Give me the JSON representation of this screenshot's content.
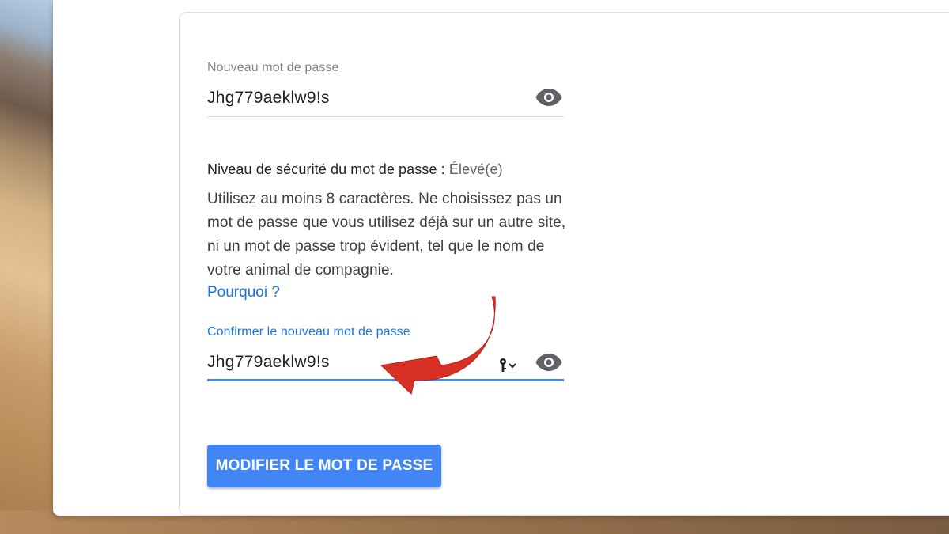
{
  "new_password": {
    "label": "Nouveau mot de passe",
    "value": "Jhg779aeklw9!s",
    "toggle_icon": "eye-icon"
  },
  "strength": {
    "label": "Niveau de sécurité du mot de passe :",
    "level": "Élevé(e)"
  },
  "help_text": "Utilisez au moins 8 caractères. Ne choisissez pas un mot de passe que vous utilisez déjà sur un autre site, ni un mot de passe trop évident, tel que le nom de votre animal de compagnie.",
  "why_link": "Pourquoi ?",
  "confirm_password": {
    "label": "Confirmer le nouveau mot de passe",
    "value": "Jhg779aeklw9!s",
    "key_icon": "key-dropdown-icon",
    "toggle_icon": "eye-icon"
  },
  "submit_label": "MODIFIER LE MOT DE PASSE",
  "colors": {
    "primary_blue": "#4285f4",
    "link_blue": "#1a73e8",
    "annotation_arrow": "#d93025"
  }
}
